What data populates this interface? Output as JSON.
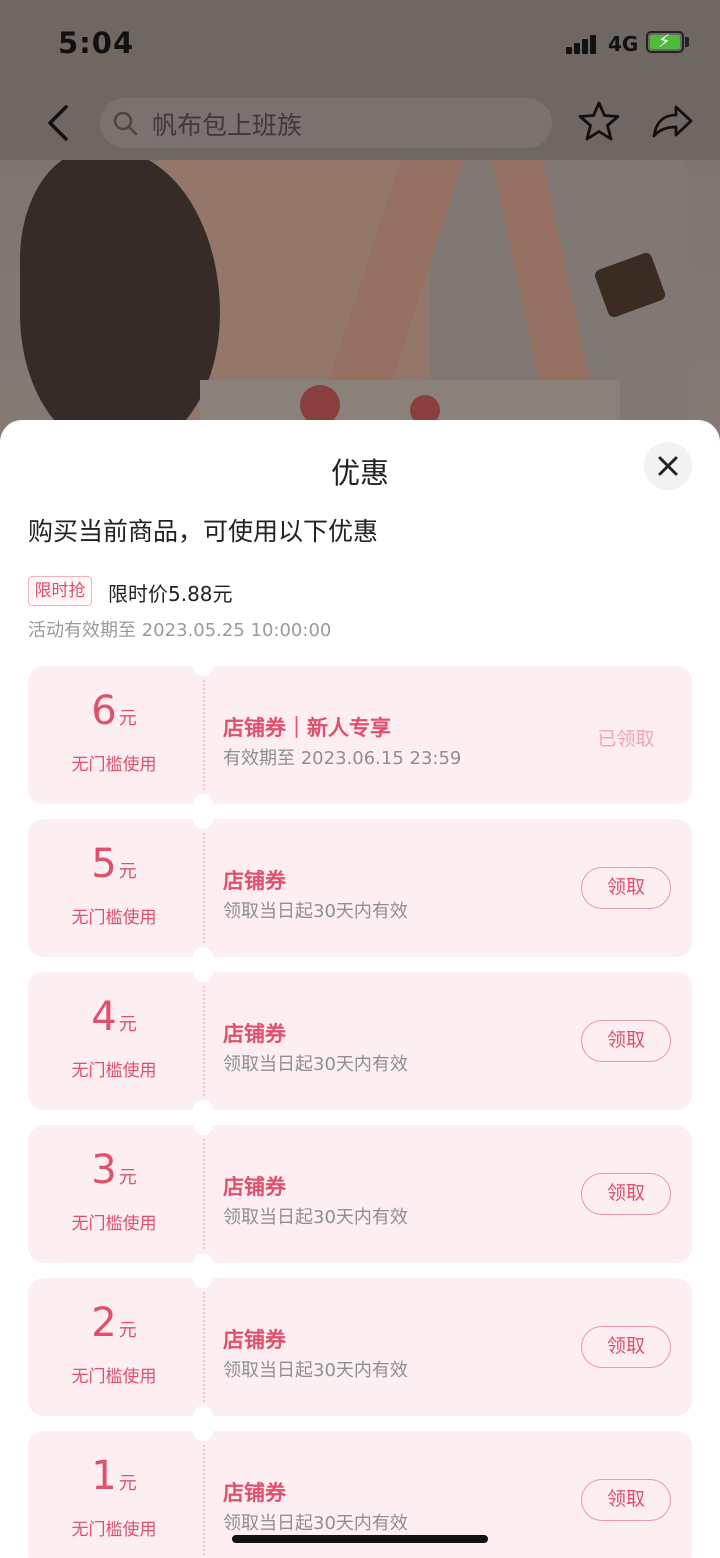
{
  "status_bar": {
    "time": "5:04",
    "network": "4G"
  },
  "nav": {
    "search_text": "帆布包上班族"
  },
  "sheet": {
    "title": "优惠",
    "subtitle": "购买当前商品，可使用以下优惠",
    "promo": {
      "tag": "限时抢",
      "price_text": "限时价5.88元",
      "period": "活动有效期至 2023.05.25 10:00:00"
    },
    "coupons": [
      {
        "amount": "6",
        "unit": "元",
        "condition": "无门槛使用",
        "title": "店铺券｜新人专享",
        "validity": "有效期至 2023.06.15 23:59",
        "action": "已领取",
        "claimed": true
      },
      {
        "amount": "5",
        "unit": "元",
        "condition": "无门槛使用",
        "title": "店铺券",
        "validity": "领取当日起30天内有效",
        "action": "领取",
        "claimed": false
      },
      {
        "amount": "4",
        "unit": "元",
        "condition": "无门槛使用",
        "title": "店铺券",
        "validity": "领取当日起30天内有效",
        "action": "领取",
        "claimed": false
      },
      {
        "amount": "3",
        "unit": "元",
        "condition": "无门槛使用",
        "title": "店铺券",
        "validity": "领取当日起30天内有效",
        "action": "领取",
        "claimed": false
      },
      {
        "amount": "2",
        "unit": "元",
        "condition": "无门槛使用",
        "title": "店铺券",
        "validity": "领取当日起30天内有效",
        "action": "领取",
        "claimed": false
      },
      {
        "amount": "1",
        "unit": "元",
        "condition": "无门槛使用",
        "title": "店铺券",
        "validity": "领取当日起30天内有效",
        "action": "领取",
        "claimed": false
      }
    ]
  },
  "colors": {
    "accent": "#e0506b",
    "coupon_bg": "#fdeef1",
    "claimed": "#f2a6b4",
    "overlay": "#6e6762"
  }
}
